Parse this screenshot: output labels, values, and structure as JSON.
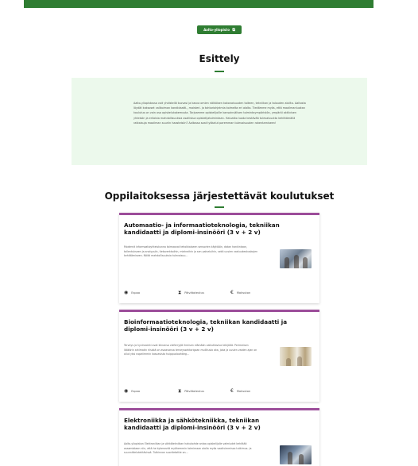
{
  "cta": {
    "label": "Aalto-yliopisto"
  },
  "intro": {
    "title": "Esittely",
    "text": "Aalto-yliopistossa voit yhdistellä tuovasi ja kasva omien nälköisen kokonaisuuden taiteen, tekniikan ja talouden aloilta. Aaltosta löydät kaksoset valikoiman kandidaatti-, maisteri- ja tohtoriohjelmia kolmelta eri alalta. Tiedämme myös, että maailmanluokan koulutus on vain osa opiskelukokemusta. Tarjoamme opiskelijoille kansainvälisen toimintaympäristön, ympäröi aktiivisen yhteisön ja erilaisia mahdollisuuksia osallistua opiskelijatoimintaan. Haluatko luoda kestävää tulevaisuutta kehittämällä ratkaisuja maailman suuriin haasteisiin? Aaltossa saat työkalut paremman tulevaisuuden rakentamiseen!"
  },
  "programs": {
    "title": "Oppilaitoksessa järjestettävät koulutukset",
    "meta_labels": {
      "location": "Espoo",
      "duration": "Päivätoteutus",
      "price": "Maksuton"
    },
    "items": [
      {
        "title": "Automaatio- ja informaatioteknologia, tekniikan kandidaatti ja diplomi-insinööri (3 v + 2 v)",
        "desc": "Modernit informaatioyhteiskunna toimaavat tehokkaiseen sensorien käyttöön, datan hankintaan, tallentukseen ja analyysiin, tietoverkkoihin, mielneihin ja sen palveluihin, sekä uusien vastuukeskuskojen kehittämiseen. Näitä mahdollisuuksia tulevaisuu..."
      },
      {
        "title": "Bioinformaatioteknologia, tekniikan kandidaatti ja diplomi-insinööri (3 v + 2 v)",
        "desc": "Terveys ja hyvinvointi ovat kiinansa vieferryjät ihmisen elämään vaikuttaviva tekijöitä. Perimeisen lääkärin arkimatin riisistä on avaavansa terveyssektorigoan mullitusia aka, joka ja uusien vaiden ajan on ollut yksi nopeiimmin kasvavista huippualoohtieg..."
      },
      {
        "title": "Elektroniikka ja sähkötekniikka, tekniikan kandidaatti ja diplomi-insinööri (3 v + 2 v)",
        "desc": "Aalto-yliopiston Elektroniikan ja sähkötekniikan hakukohde antaa opiskelijolle valmiudet kehittää osaamistaan niin, että he kykenevät myöhemmin toimimaan alalla myös vaativimmissa tutkimus- ja suunnittelutehtävissä. Tutkinnon suoritetattie on..."
      }
    ]
  },
  "colors": {
    "accent": "#2f7d32",
    "card_border": "#9c4d9a",
    "intro_bg": "#ecf9ec"
  }
}
